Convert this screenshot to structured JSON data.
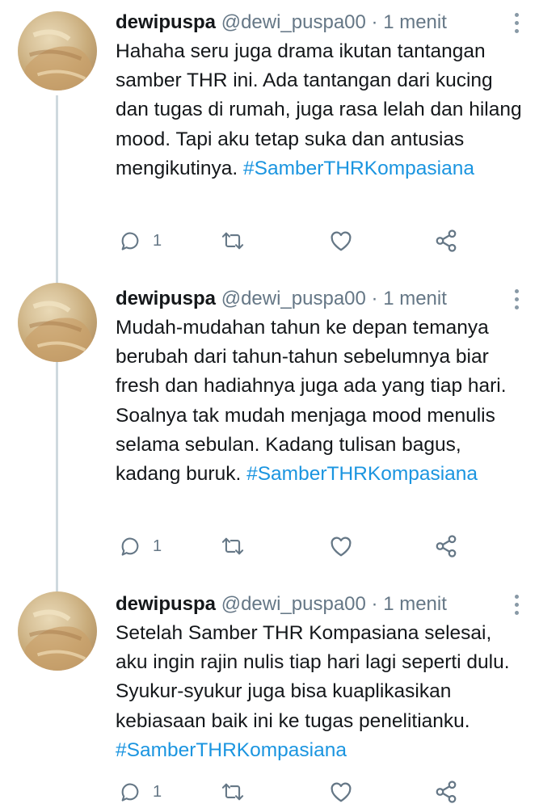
{
  "tweets": [
    {
      "name": "dewipuspa",
      "handle": "@dewi_puspa00",
      "separator": "·",
      "time": "1 menit",
      "text": "Hahaha seru juga drama ikutan tantangan samber THR ini. Ada tantangan dari kucing dan tugas di rumah, juga rasa lelah dan hilang mood. Tapi aku tetap suka dan antusias mengikutinya.",
      "hashtag": "#SamberTHRKompasiana",
      "reply_count": "1"
    },
    {
      "name": "dewipuspa",
      "handle": "@dewi_puspa00",
      "separator": "·",
      "time": "1 menit",
      "text": "Mudah-mudahan tahun ke depan temanya berubah dari tahun-tahun sebelumnya biar fresh dan hadiahnya juga ada yang tiap hari. Soalnya tak mudah menjaga mood menulis selama sebulan. Kadang tulisan bagus, kadang buruk.",
      "hashtag": "#SamberTHRKompasiana",
      "reply_count": "1"
    },
    {
      "name": "dewipuspa",
      "handle": "@dewi_puspa00",
      "separator": "·",
      "time": "1 menit",
      "text": "Setelah Samber THR Kompasiana selesai, aku ingin rajin nulis tiap hari lagi seperti dulu. Syukur-syukur juga bisa kuaplikasikan kebiasaan baik ini ke tugas penelitianku.",
      "hashtag": "#SamberTHRKompasiana",
      "reply_count": "1"
    }
  ],
  "icons": {
    "reply": "reply-icon",
    "retweet": "retweet-icon",
    "like": "heart-icon",
    "share": "share-icon",
    "more": "more-vertical-icon"
  },
  "colors": {
    "text": "#14171a",
    "secondary": "#657786",
    "hashtag": "#1b95e0",
    "thread_line": "#cfd9de"
  }
}
